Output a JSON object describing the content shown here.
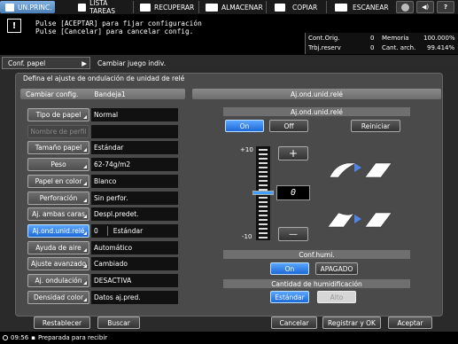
{
  "tabs": {
    "home": "UN.PRINC.",
    "jobs": "LISTA TAREAS",
    "recall": "RECUPERAR",
    "store": "ALMACENAR",
    "copy": "COPIAR",
    "scan": "ESCANEAR"
  },
  "message": {
    "line1": "Pulse [ACEPTAR] para fijar configuración",
    "line2": "Pulse [Cancelar] para cancelar config."
  },
  "counters": {
    "cont_orig_label": "Cont.Orig.",
    "cont_orig_value": "0",
    "memoria_label": "Memoria",
    "memoria_value": "100.000%",
    "trbj_label": "Trbj.reserv",
    "trbj_value": "0",
    "cant_label": "Cant. arch.",
    "cant_value": "99.414%"
  },
  "breadcrumb": {
    "item1": "Conf. papel",
    "item2": "Cambiar juego indiv."
  },
  "main_title": "Defina el ajuste de ondulación de unidad de relé",
  "left_header": {
    "left": "Cambiar config.",
    "right": "Bandeja1"
  },
  "settings": [
    {
      "label": "Tipo de papel",
      "value": "Normal"
    },
    {
      "label": "Nombre de perfil",
      "value": ""
    },
    {
      "label": "Tamaño papel",
      "value": "Estándar"
    },
    {
      "label": "Peso",
      "value": "62-74g/m2"
    },
    {
      "label": "Papel en color",
      "value": "Blanco"
    },
    {
      "label": "Perforación",
      "value": "Sin perfor."
    },
    {
      "label": "Aj. ambas caras",
      "value": "Despl.predet."
    },
    {
      "label": "Aj.ond.unid.relé",
      "value": "0",
      "value2": "Estándar"
    },
    {
      "label": "Ayuda de aire",
      "value": "Automático"
    },
    {
      "label": "Ajuste avanzado",
      "value": "Cambiado"
    },
    {
      "label": "Aj. ondulación",
      "value": "DESACTIVA"
    },
    {
      "label": "Densidad color",
      "value": "Datos aj.pred."
    }
  ],
  "right": {
    "header": "Aj.ond.unid.relé",
    "subheader": "Aj.ond.unid.relé",
    "on_label": "On",
    "off_label": "Off",
    "reset_label": "Reiniciar",
    "scale_max": "+10",
    "scale_min": "-10",
    "value": "0",
    "plus": "+",
    "minus": "—",
    "humid_header": "Conf.humi.",
    "humid_on": "On",
    "humid_off": "APAGADO",
    "amount_header": "Cantidad de humidificación",
    "amount_standard": "Estándar",
    "amount_high": "Alto"
  },
  "bottom": {
    "restore": "Restablecer",
    "search": "Buscar",
    "cancel": "Cancelar",
    "register_ok": "Registrar y OK",
    "accept": "Aceptar"
  },
  "status": {
    "time": "09:56",
    "text": "Preparada para recibir"
  },
  "colors": {
    "accent_blue": "#1d6ad8",
    "arrow_blue": "#4f86e6"
  }
}
